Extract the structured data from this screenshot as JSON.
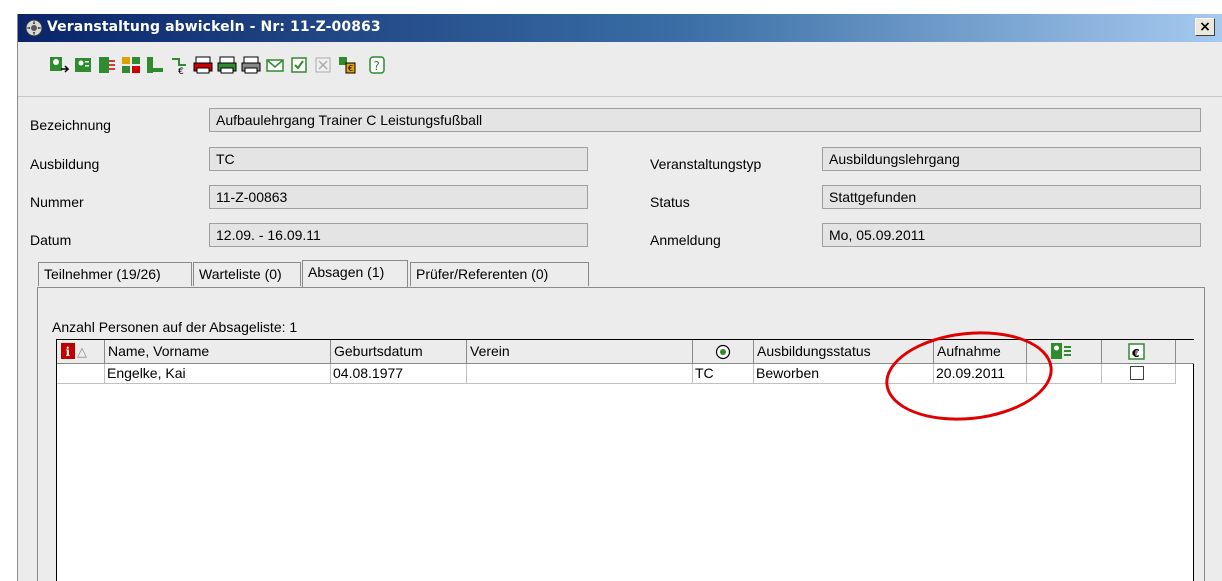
{
  "window": {
    "title": "Veranstaltung abwickeln - Nr: 11-Z-00863",
    "close_label": "×"
  },
  "toolbar": {
    "icons": [
      "person-arrow-icon",
      "person-card-icon",
      "person-list-icon",
      "people-grid-icon",
      "person-edit-icon",
      "transfer-euro-icon",
      "printer-icon",
      "printer-2-icon",
      "printer-3-icon",
      "envelope-icon",
      "check-icon",
      "disabled-x-icon",
      "people-money-icon",
      "help-icon"
    ]
  },
  "form": {
    "bezeichnung_label": "Bezeichnung",
    "bezeichnung_value": "Aufbaulehrgang Trainer C Leistungsfußball",
    "ausbildung_label": "Ausbildung",
    "ausbildung_value": "TC",
    "nummer_label": "Nummer",
    "nummer_value": "11-Z-00863",
    "datum_label": "Datum",
    "datum_value": "12.09. - 16.09.11",
    "typ_label": "Veranstaltungstyp",
    "typ_value": "Ausbildungslehrgang",
    "status_label": "Status",
    "status_value": "Stattgefunden",
    "anmeldung_label": "Anmeldung",
    "anmeldung_value": "Mo, 05.09.2011"
  },
  "tabs": [
    {
      "label": "Teilnehmer (19/26)"
    },
    {
      "label": "Warteliste (0)"
    },
    {
      "label": "Absagen (1)"
    },
    {
      "label": "Prüfer/Referenten (0)"
    }
  ],
  "panel": {
    "count_text": "Anzahl Personen auf der Absageliste: 1"
  },
  "table": {
    "headers": {
      "info_icon": "info-icon",
      "name": "Name, Vorname",
      "geburtsdatum": "Geburtsdatum",
      "verein": "Verein",
      "target_icon": "target-icon",
      "ausbildungsstatus": "Ausbildungsstatus",
      "aufnahme": "Aufnahme",
      "people_icon": "people-icon",
      "euro_icon": "euro-icon"
    },
    "rows": [
      {
        "name": "Engelke, Kai",
        "geburtsdatum": "04.08.1977",
        "verein": "",
        "ausbildung": "TC",
        "ausbildungsstatus": "Beworben",
        "aufnahme": "20.09.2011",
        "bezahlt": false
      }
    ]
  },
  "colors": {
    "title_gradient_start": "#0a246a",
    "highlight": "#e00000",
    "field_bg": "#e4e4e4"
  }
}
